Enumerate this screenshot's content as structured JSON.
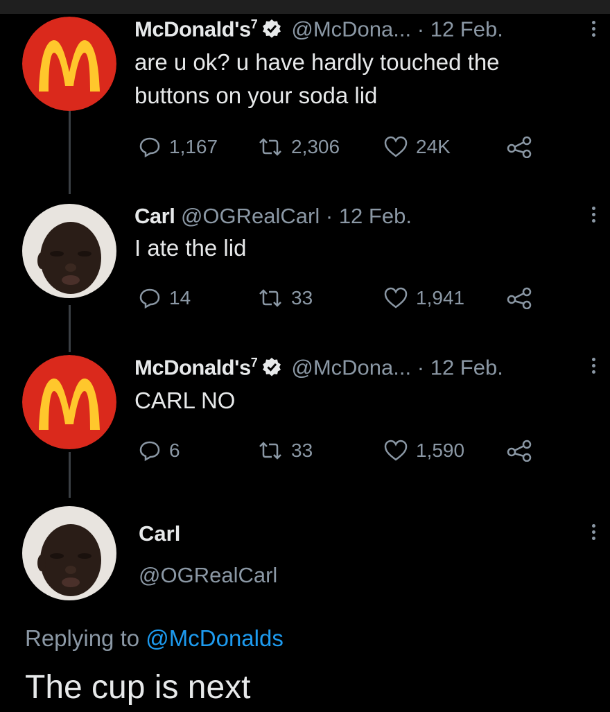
{
  "tweets": [
    {
      "name": "McDonald's",
      "superscript": "7",
      "verified": true,
      "handle": "@McDona...",
      "separator": "·",
      "date": "12 Feb.",
      "text": "are u ok? u have hardly touched the buttons on your soda lid",
      "reply_count": "1,167",
      "retweet_count": "2,306",
      "like_count": "24K",
      "avatar": "mcdonalds-logo"
    },
    {
      "name": "Carl",
      "handle": "@OGRealCarl",
      "separator": "·",
      "date": "12 Feb.",
      "text": "I ate the lid",
      "reply_count": "14",
      "retweet_count": "33",
      "like_count": "1,941",
      "avatar": "carl-photo"
    },
    {
      "name": "McDonald's",
      "superscript": "7",
      "verified": true,
      "handle": "@McDona...",
      "separator": "·",
      "date": "12 Feb.",
      "text": "CARL NO",
      "reply_count": "6",
      "retweet_count": "33",
      "like_count": "1,590",
      "avatar": "mcdonalds-logo"
    }
  ],
  "focused_tweet": {
    "name": "Carl",
    "handle": "@OGRealCarl",
    "replying_prefix": "Replying to",
    "replying_to": "@McDonalds",
    "text": "The cup is next",
    "avatar": "carl-photo"
  },
  "colors": {
    "background": "#000000",
    "text_primary": "#e7e9ea",
    "text_secondary": "#8b98a5",
    "link": "#1d9bf0",
    "mcd_red": "#da291c",
    "mcd_yellow": "#ffc72c"
  },
  "icons": [
    "reply-icon",
    "retweet-icon",
    "like-icon",
    "share-icon",
    "verified-icon",
    "more-icon"
  ]
}
